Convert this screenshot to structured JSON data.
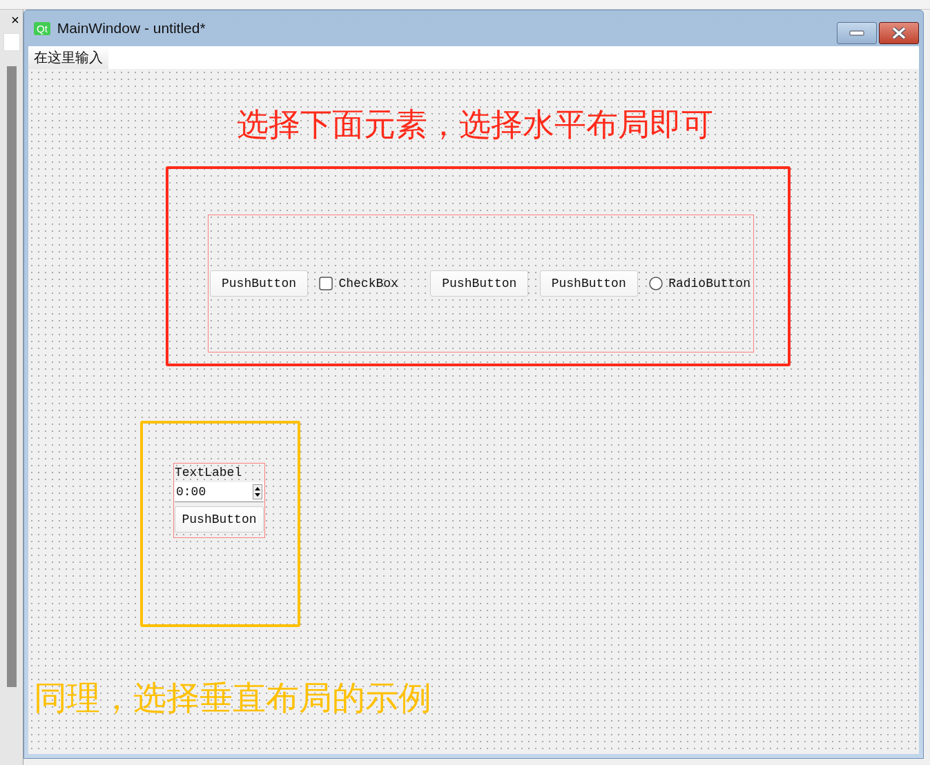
{
  "window": {
    "title": "MainWindow - untitled*",
    "app_badge": "Qt"
  },
  "menu": [
    {
      "label": "在这里输入"
    }
  ],
  "annotations": [
    {
      "kind": "heading",
      "text": "选择下面元素，选择水平布局即可",
      "color": "#ff2a1a"
    },
    {
      "kind": "caption",
      "text": "同理，选择垂直布局的示例",
      "color": "#ffc000"
    }
  ],
  "horizontal_group": {
    "color": "#ff2a1a",
    "widgets": [
      {
        "kind": "pushbutton",
        "label": "PushButton"
      },
      {
        "kind": "checkbox",
        "label": "CheckBox",
        "checked": false
      },
      {
        "kind": "pushbutton",
        "label": "PushButton"
      },
      {
        "kind": "pushbutton",
        "label": "PushButton"
      },
      {
        "kind": "radiobutton",
        "label": "RadioButton",
        "selected": false
      }
    ]
  },
  "vertical_group": {
    "color": "#ffc000",
    "widgets": [
      {
        "kind": "label",
        "label": "TextLabel"
      },
      {
        "kind": "timeedit",
        "value": "0:00"
      },
      {
        "kind": "pushbutton",
        "label": "PushButton"
      }
    ]
  }
}
